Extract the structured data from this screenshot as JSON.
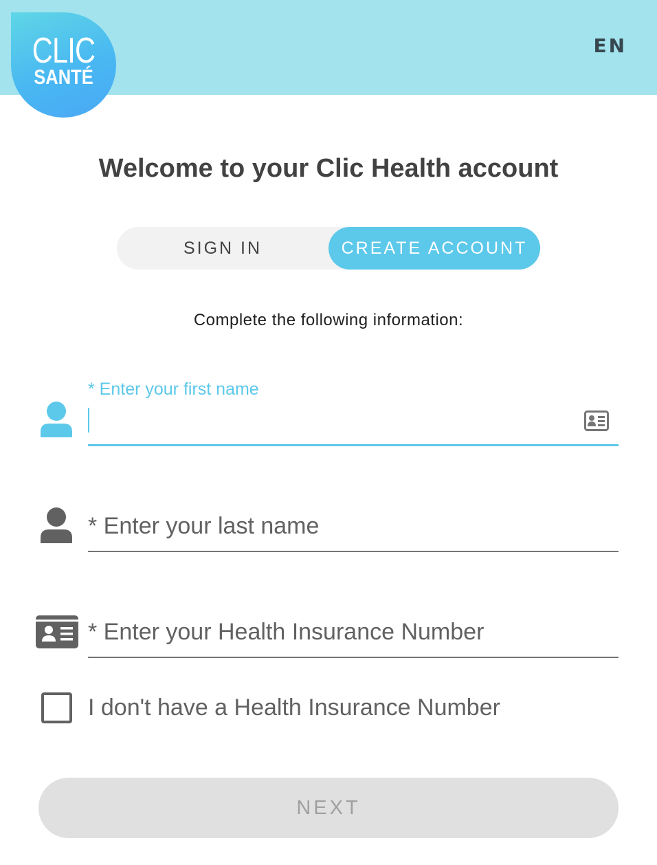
{
  "header": {
    "language": "EN",
    "logo": {
      "line1": "CLIC",
      "line2": "SANTÉ"
    }
  },
  "welcome_title": "Welcome to your Clic Health account",
  "tabs": {
    "sign_in": "SIGN IN",
    "create_account": "CREATE ACCOUNT",
    "active": "create_account"
  },
  "instruction": "Complete the following information:",
  "form": {
    "first_name": {
      "label": "* Enter your first name",
      "value": "",
      "focused": true
    },
    "last_name": {
      "label": "* Enter your last name",
      "value": ""
    },
    "health_insurance_number": {
      "label": "* Enter your Health Insurance Number",
      "value": ""
    },
    "no_hin_checkbox": {
      "label": "I don't have a Health Insurance Number",
      "checked": false
    }
  },
  "next_button": {
    "label": "NEXT",
    "disabled": true
  },
  "colors": {
    "header_bg": "#a2e3ee",
    "accent": "#5cc8ea",
    "icon_gray": "#616161",
    "disabled_bg": "#e0e0e0",
    "disabled_text": "#a0a0a0"
  },
  "icons": {
    "first_name": "user-icon",
    "last_name": "user-icon",
    "health_card": "id-card-icon",
    "contact_card_autofill": "contact-card-icon"
  }
}
